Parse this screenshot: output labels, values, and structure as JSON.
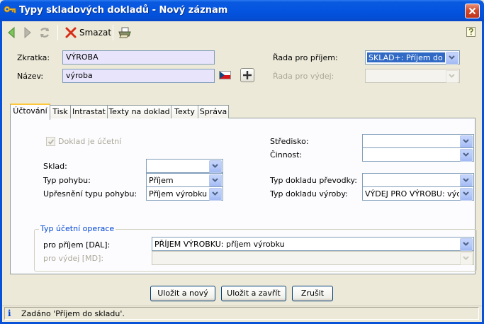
{
  "window": {
    "title": "Typy skladových dokladů - Nový záznam"
  },
  "toolbar": {
    "delete_label": "Smazat"
  },
  "header": {
    "zkratka_label": "Zkratka:",
    "zkratka_value": "VÝROBA",
    "nazev_label": "Název:",
    "nazev_value": "výroba",
    "rada_prijem_label": "Řada pro příjem:",
    "rada_prijem_value": "SKLAD+: Příjem do ...",
    "rada_vydej_label": "Řada pro výdej:",
    "rada_vydej_value": ""
  },
  "tabs": [
    {
      "label": "Účtování"
    },
    {
      "label": "Tisk"
    },
    {
      "label": "Intrastat"
    },
    {
      "label": "Texty na doklad"
    },
    {
      "label": "Texty"
    },
    {
      "label": "Správa"
    }
  ],
  "accounting": {
    "doklad_ucetni_label": "Doklad je účetní",
    "doklad_ucetni_checked": true,
    "stredisko_label": "Středisko:",
    "stredisko_value": "",
    "cinnost_label": "Činnost:",
    "cinnost_value": "",
    "sklad_label": "Sklad:",
    "sklad_value": "",
    "typ_pohybu_label": "Typ pohybu:",
    "typ_pohybu_value": "Příjem",
    "upresneni_label": "Upřesnění typu pohybu:",
    "upresneni_value": "Příjem výrobku",
    "typ_prevodky_label": "Typ dokladu převodky:",
    "typ_prevodky_value": "",
    "typ_vyroby_label": "Typ dokladu výroby:",
    "typ_vyroby_value": "VÝDEJ PRO VÝROBU: výd..."
  },
  "operation_group": {
    "title": "Typ účetní operace",
    "prijem_label": "pro příjem [DAL]:",
    "prijem_value": "PŘÍJEM VÝROBKU: příjem výrobku",
    "vydej_label": "pro výdej [MD]:",
    "vydej_value": ""
  },
  "buttons": {
    "save_new": "Uložit a nový",
    "save_close": "Uložit a zavřít",
    "cancel": "Zrušit"
  },
  "status": {
    "text": "Zadáno 'Příjem do skladu'."
  },
  "colors": {
    "titlebar": "#0454e0",
    "highlight_field": "#e8e4fc",
    "selection": "#316ac5",
    "active_tab_top": "#ffc83c",
    "groupbox_title": "#0046d5"
  }
}
